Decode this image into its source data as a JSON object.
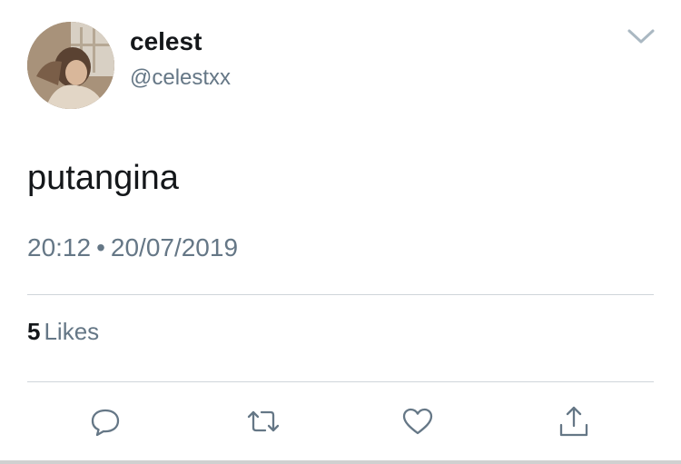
{
  "tweet": {
    "author": {
      "display_name": "celest",
      "handle": "@celestxx",
      "avatar_icon": "profile-photo"
    },
    "text": "putangina",
    "time": "20:12",
    "separator": "•",
    "date": "20/07/2019",
    "likes": {
      "count": "5",
      "label": "Likes"
    }
  },
  "actions": {
    "reply_icon": "speech-bubble-icon",
    "retweet_icon": "retweet-arrows-icon",
    "like_icon": "heart-icon",
    "share_icon": "share-upload-icon",
    "more_icon": "chevron-down-icon"
  },
  "colors": {
    "primary_text": "#14171a",
    "secondary_text": "#657786",
    "divider": "#cfd5da",
    "icon": "#657786"
  }
}
